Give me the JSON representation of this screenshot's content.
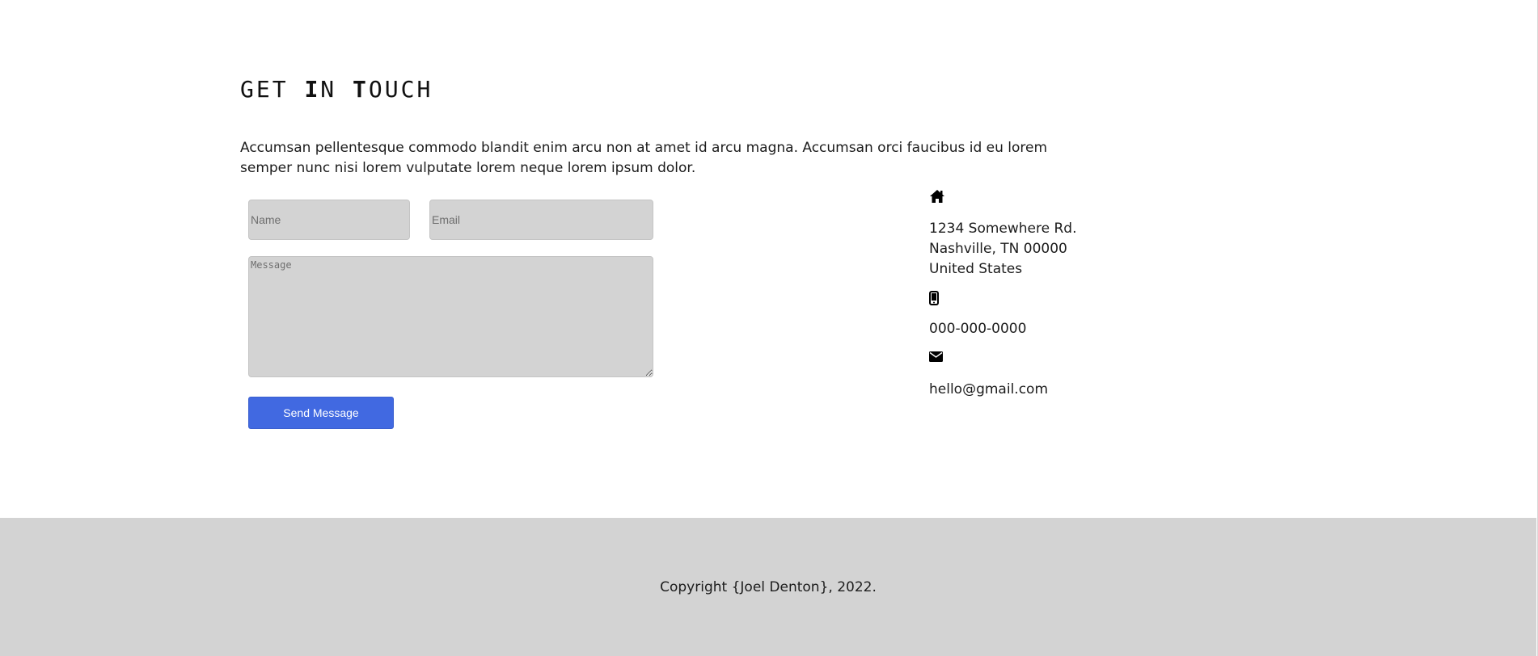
{
  "contact": {
    "heading": {
      "part1": "GET ",
      "part2": "I",
      "part3": "N ",
      "part4": "T",
      "part5": "OUCH"
    },
    "intro": "Accumsan pellentesque commodo blandit enim arcu non at amet id arcu magna. Accumsan orci faucibus id eu lorem semper nunc nisi lorem vulputate lorem neque lorem ipsum dolor.",
    "form": {
      "name_placeholder": "Name",
      "email_placeholder": "Email",
      "message_placeholder": "Message",
      "send_label": "Send Message",
      "send_color": "#4169e1"
    },
    "info": {
      "address_icon": "home-icon",
      "address_line1": "1234 Somewhere Rd.",
      "address_line2": "Nashville, TN 00000",
      "address_line3": "United States",
      "phone_icon": "mobile-phone-icon",
      "phone": "000-000-0000",
      "email_icon": "envelope-icon",
      "email": "hello@gmail.com"
    }
  },
  "footer": {
    "copyright": "Copyright {Joel Denton}, 2022.",
    "background": "#d3d3d3"
  }
}
